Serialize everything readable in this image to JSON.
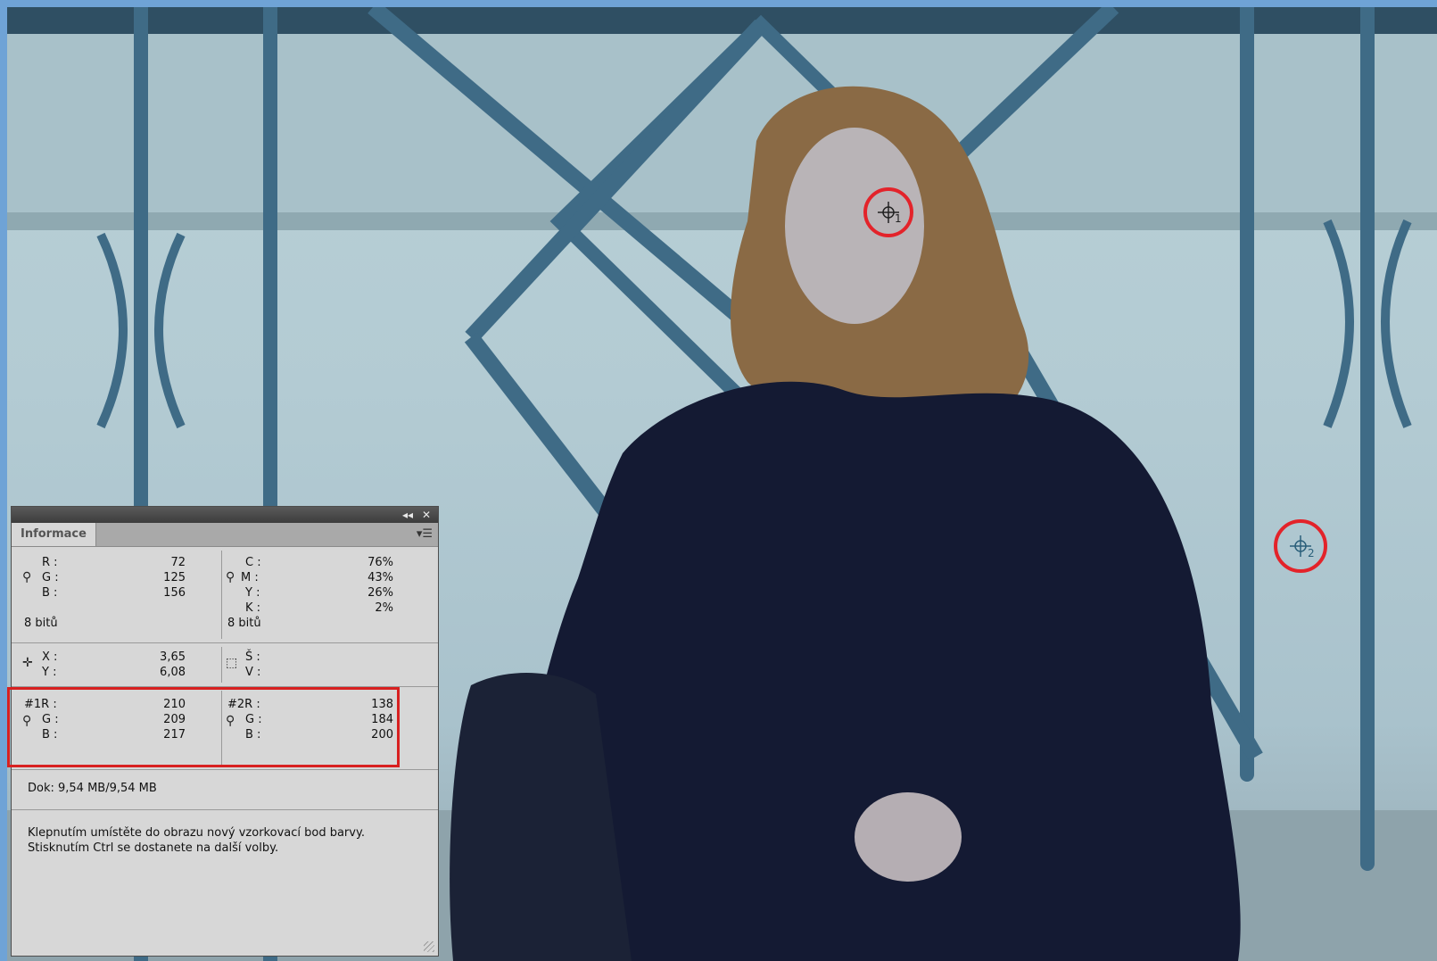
{
  "panel": {
    "tab_label": "Informace",
    "titlebar_collapse": "◂◂",
    "titlebar_close": "✕",
    "menu_icon": "panel-menu-icon",
    "rgb": {
      "r_label": "R :",
      "g_label": "G :",
      "b_label": "B :",
      "r": "72",
      "g": "125",
      "b": "156",
      "bits": "8 bitů"
    },
    "cmyk": {
      "c_label": "C :",
      "m_label": "M :",
      "y_label": "Y :",
      "k_label": "K :",
      "c": "76%",
      "m": "43%",
      "y": "26%",
      "k": "2%",
      "bits": "8 bitů"
    },
    "position": {
      "x_label": "X :",
      "y_label": "Y :",
      "x": "3,65",
      "y": "6,08",
      "w_label": "Š :",
      "h_label": "V :"
    },
    "sample1": {
      "r_label": "#1R :",
      "g_label": "G :",
      "b_label": "B :",
      "r": "210",
      "g": "209",
      "b": "217"
    },
    "sample2": {
      "r_label": "#2R :",
      "g_label": "G :",
      "b_label": "B :",
      "r": "138",
      "g": "184",
      "b": "200"
    },
    "doc": "Dok: 9,54 MB/9,54 MB",
    "hint_line1": "Klepnutím umístěte do obrazu nový vzorkovací bod barvy.",
    "hint_line2": "Stisknutím Ctrl se dostanete na další volby."
  },
  "markers": [
    {
      "label": "1"
    },
    {
      "label": "2"
    }
  ],
  "colors": {
    "highlight": "#e3232a",
    "fence": "#3f6b86",
    "coat": "#141a33",
    "hair": "#8a6a45"
  }
}
